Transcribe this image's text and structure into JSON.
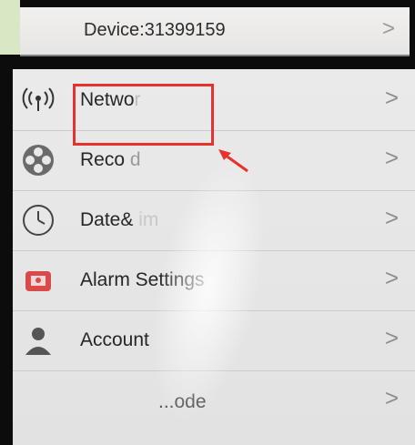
{
  "header": {
    "device_label": "Device:31399159",
    "chevron": ">"
  },
  "menu": [
    {
      "label": "Netwo",
      "label_tail": "r",
      "icon": "network-icon"
    },
    {
      "label": "Reco",
      "label_tail": "d",
      "icon": "record-icon"
    },
    {
      "label": "Date&",
      "label_tail": "im",
      "icon": "clock-icon"
    },
    {
      "label": "Alarm Settings",
      "icon": "alarm-icon"
    },
    {
      "label": "Account",
      "icon": "account-icon"
    },
    {
      "label": "...ode",
      "icon": "mode-icon"
    }
  ],
  "colors": {
    "highlight": "#e5322d",
    "accent_icon": "#d94b4b"
  }
}
